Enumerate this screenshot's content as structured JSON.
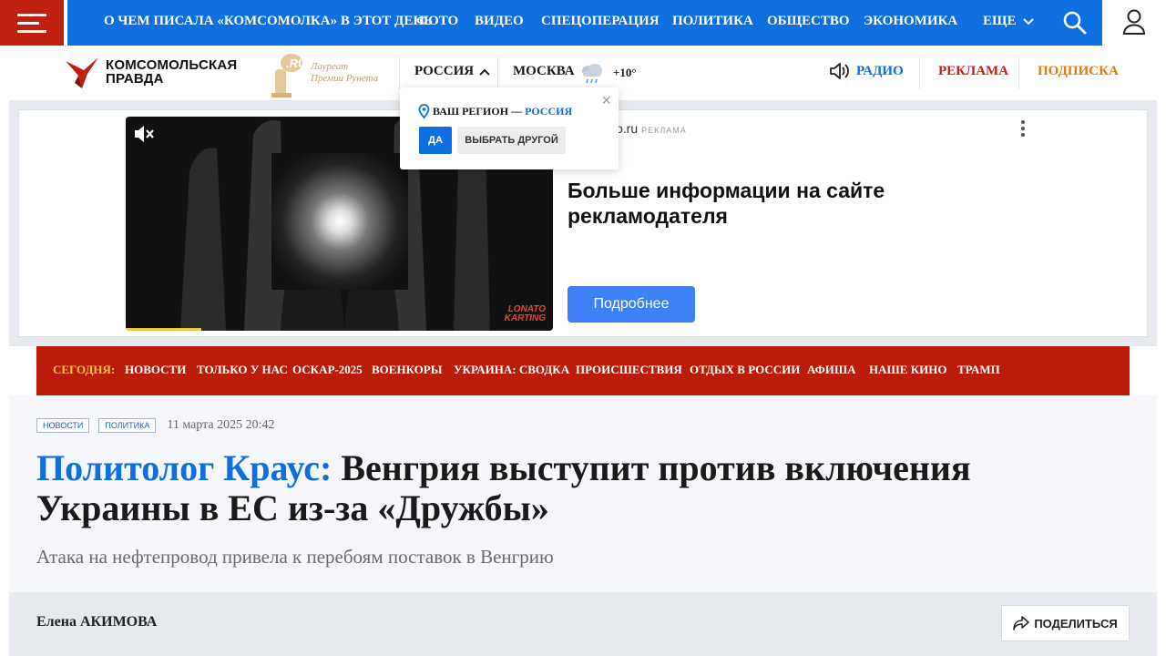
{
  "topnav": {
    "items": [
      "О ЧЕМ ПИСАЛА «КОМСОМОЛКА» В ЭТОТ ДЕНЬ",
      "ФОТО",
      "ВИДЕО",
      "СПЕЦОПЕРАЦИЯ",
      "ПОЛИТИКА",
      "ОБЩЕСТВО",
      "ЭКОНОМИКА",
      "ЕЩЕ"
    ],
    "icons": [
      "menu-icon",
      "search-icon",
      "user-icon",
      "chevron-down-icon"
    ]
  },
  "header": {
    "logo_line1": "КОМСОМОЛЬСКАЯ",
    "logo_line2": "ПРАВДА",
    "laureat_line1": "Лауреат",
    "laureat_line2": "Премии Рунета",
    "region": "РОССИЯ",
    "city": "МОСКВА",
    "temperature": "+10°",
    "radio": "РАДИО",
    "reklama": "РЕКЛАМА",
    "podpiska": "ПОДПИСКА",
    "colors": {
      "blue": "#0d6fe0",
      "red": "#c0200f",
      "orange": "#e8780a"
    }
  },
  "region_popup": {
    "question": "ВАШ РЕГИОН —",
    "region": "РОССИЯ",
    "yes": "ДА",
    "other": "ВЫБРАТЬ ДРУГОЙ",
    "close": "×"
  },
  "ad": {
    "domain": "o.ru",
    "label": "РЕКЛАМА",
    "title": "Больше информации на сайте рекламодателя",
    "button": "Подробнее",
    "video_brand_line1": "LONATO",
    "video_brand_line2": "KARTING"
  },
  "trending": {
    "today": "СЕГОДНЯ:",
    "items": [
      "НОВОСТИ",
      "ТОЛЬКО У НАС",
      "ОСКАР-2025",
      "ВОЕНКОРЫ",
      "УКРАИНА: СВОДКА",
      "ПРОИСШЕСТВИЯ",
      "ОТДЫХ В РОССИИ",
      "АФИША",
      "НАШЕ КИНО",
      "ТРАМП"
    ]
  },
  "article": {
    "tags": [
      "НОВОСТИ",
      "ПОЛИТИКА"
    ],
    "date": "11 марта 2025 20:42",
    "headline_speaker": "Политолог Краус:",
    "headline_rest": " Венгрия выступит против включения Украины в ЕС из-за «Дружбы»",
    "subheadline": "Атака на нефтепровод привела к перебоям поставок в Венгрию",
    "author": "Елена АКИМОВА",
    "share": "ПОДЕЛИТЬСЯ"
  }
}
